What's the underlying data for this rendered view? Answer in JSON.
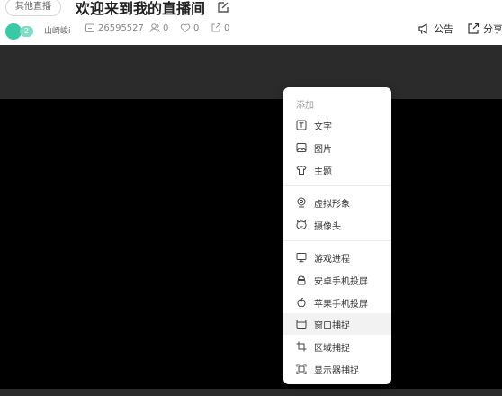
{
  "header": {
    "category": "其他直播",
    "title": "欢迎来到我的直播间",
    "level": "2",
    "username": "山崎峻i",
    "room_id": "26595527",
    "followers": "0",
    "likes": "0",
    "shares": "0",
    "announcement": "公告",
    "share": "分享"
  },
  "menu": {
    "header": "添加",
    "items": [
      {
        "label": "文字",
        "icon": "text-icon"
      },
      {
        "label": "图片",
        "icon": "image-icon"
      },
      {
        "label": "主题",
        "icon": "shirt-icon"
      },
      {
        "label": "虚拟形象",
        "icon": "avatar-icon"
      },
      {
        "label": "摄像头",
        "icon": "camera-icon"
      },
      {
        "label": "游戏进程",
        "icon": "monitor-icon"
      },
      {
        "label": "安卓手机投屏",
        "icon": "android-icon"
      },
      {
        "label": "苹果手机投屏",
        "icon": "apple-icon"
      },
      {
        "label": "窗口捕捉",
        "icon": "window-icon"
      },
      {
        "label": "区域捕捉",
        "icon": "crop-icon"
      },
      {
        "label": "显示器捕捉",
        "icon": "screen-capture-icon"
      }
    ],
    "highlighted": "窗口捕捉"
  },
  "colors": {
    "stage": "#000000",
    "stage_bar": "#2b2b2b",
    "accent_green": "#38c9a5"
  }
}
